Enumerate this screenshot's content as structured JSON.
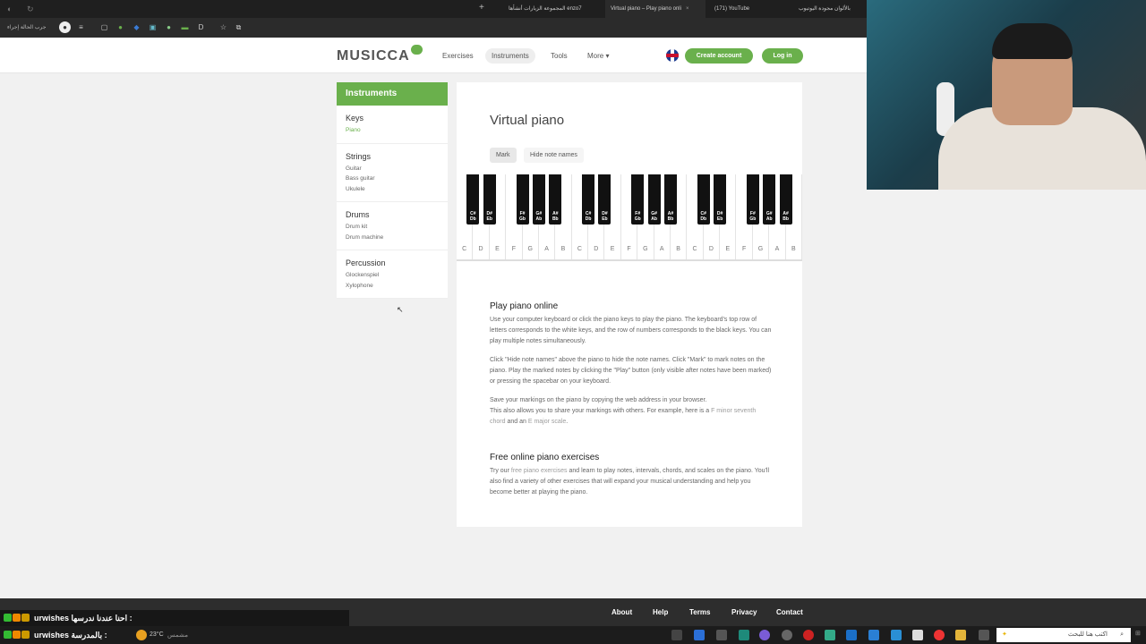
{
  "browser": {
    "tabs": [
      {
        "label": "المجموعة الزيارات أنشأها enzo7",
        "active": false
      },
      {
        "label": "Virtual piano – Play piano onli",
        "active": true
      },
      {
        "label": "(171) YouTube",
        "active": false
      },
      {
        "label": "بالألوان مجودة اليوتيوب",
        "active": false
      }
    ],
    "bookmark_label": "جرب الحالة إجراء"
  },
  "site": {
    "nav": {
      "exercises": "Exercises",
      "instruments": "Instruments",
      "tools": "Tools",
      "more": "More"
    },
    "create_account": "Create account",
    "login": "Log in"
  },
  "sidebar": {
    "title": "Instruments",
    "groups": [
      {
        "name": "Keys",
        "items": [
          "Piano"
        ]
      },
      {
        "name": "Strings",
        "items": [
          "Guitar",
          "Bass guitar",
          "Ukulele"
        ]
      },
      {
        "name": "Drums",
        "items": [
          "Drum kit",
          "Drum machine"
        ]
      },
      {
        "name": "Percussion",
        "items": [
          "Glockenspiel",
          "Xylophone"
        ]
      }
    ]
  },
  "main": {
    "title": "Virtual piano",
    "mark": "Mark",
    "hide_notes": "Hide note names",
    "white_keys": [
      "C",
      "D",
      "E",
      "F",
      "G",
      "A",
      "B",
      "C",
      "D",
      "E",
      "F",
      "G",
      "A",
      "B",
      "C",
      "D",
      "E",
      "F",
      "G",
      "A",
      "B"
    ],
    "black_keys": [
      [
        "C#",
        "Db"
      ],
      [
        "D#",
        "Eb"
      ],
      [
        "F#",
        "Gb"
      ],
      [
        "G#",
        "Ab"
      ],
      [
        "A#",
        "Bb"
      ],
      [
        "C#",
        "Db"
      ],
      [
        "D#",
        "Eb"
      ],
      [
        "F#",
        "Gb"
      ],
      [
        "G#",
        "Ab"
      ],
      [
        "A#",
        "Bb"
      ],
      [
        "C#",
        "Db"
      ],
      [
        "D#",
        "Eb"
      ],
      [
        "F#",
        "Gb"
      ],
      [
        "G#",
        "Ab"
      ],
      [
        "A#",
        "Bb"
      ]
    ],
    "section1_title": "Play piano online",
    "p1": "Use your computer keyboard or click the piano keys to play the piano. The keyboard's top row of letters corresponds to the white keys, and the row of numbers corresponds to the black keys. You can play multiple notes simultaneously.",
    "p2": "Click \"Hide note names\" above the piano to hide the note names. Click \"Mark\" to mark notes on the piano. Play the marked notes by clicking the \"Play\" button (only visible after notes have been marked) or pressing the spacebar on your keyboard.",
    "p3a": "Save your markings on the piano by copying the web address in your browser.",
    "p3b": "This also allows you to share your markings with others. For example, here is a",
    "p3_link1": "F minor seventh chord",
    "p3_and": "and an",
    "p3_link2": "E major scale",
    "section2_title": "Free online piano exercises",
    "p4a": "Try our",
    "p4_link": "free piano exercises",
    "p4b": "and learn to play notes, intervals, chords, and scales on the piano. You'll also find a variety of other exercises that will expand your musical understanding and help you become better at playing the piano."
  },
  "footer": {
    "about": "About",
    "help": "Help",
    "terms": "Terms",
    "privacy": "Privacy",
    "contact": "Contact"
  },
  "chat": [
    {
      "user": "urwishes",
      "msg": "احنا عندنا ندرسها :"
    },
    {
      "user": "urwishes",
      "msg": "بالمدرسة :"
    }
  ],
  "taskbar": {
    "weather": "23°C",
    "weather_desc": "مشمس",
    "search": "اكتب هنا للبحث"
  }
}
